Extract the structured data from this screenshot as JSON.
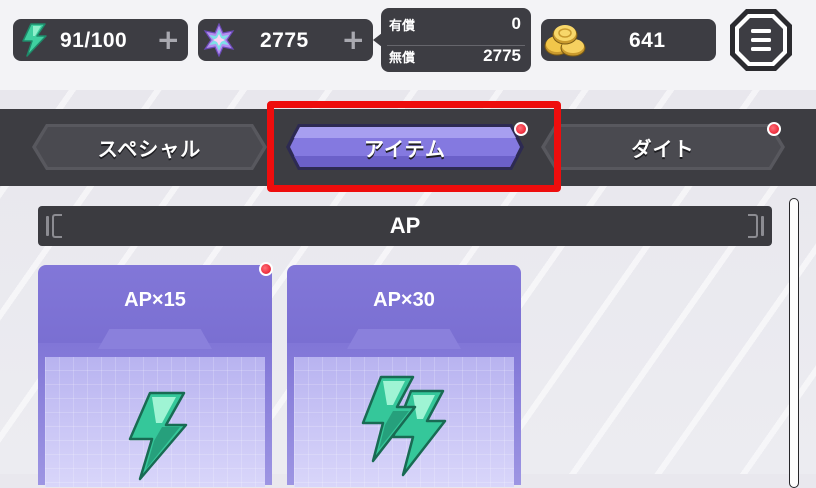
{
  "resources": {
    "ap": {
      "value": "91/100",
      "icon": "lightning-icon",
      "plus": "+"
    },
    "crystals": {
      "value": "2775",
      "icon": "crystal-icon",
      "plus": "+"
    },
    "crystal_breakdown": {
      "paid_label": "有償",
      "paid_value": "0",
      "free_label": "無償",
      "free_value": "2775"
    },
    "coins": {
      "value": "641",
      "icon": "coins-icon"
    }
  },
  "menu": {
    "icon": "hamburger-menu-icon"
  },
  "tabs": [
    {
      "label": "スペシャル",
      "selected": false,
      "has_notification": false
    },
    {
      "label": "アイテム",
      "selected": true,
      "has_notification": true
    },
    {
      "label": "ダイト",
      "selected": false,
      "has_notification": true
    }
  ],
  "section": {
    "title": "AP"
  },
  "cards": [
    {
      "title": "AP×15",
      "icon": "lightning-icon",
      "has_notification": true
    },
    {
      "title": "AP×30",
      "icon": "double-lightning-icon",
      "has_notification": false
    }
  ],
  "colors": {
    "accent_purple": "#7f74d6",
    "highlight_red": "#ee0d0d",
    "ap_green": "#3fd0a0",
    "dark_panel": "#3d3d43"
  }
}
